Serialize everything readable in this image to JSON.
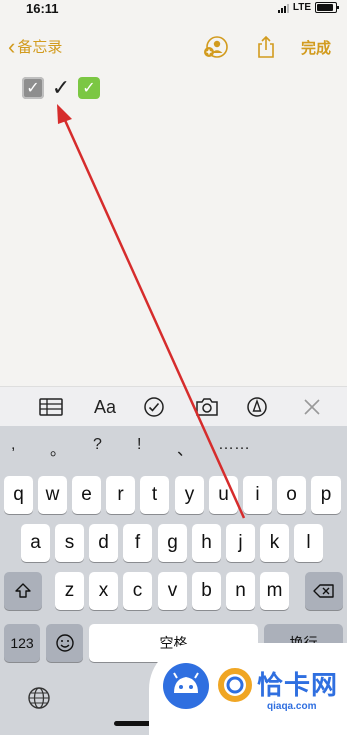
{
  "status_bar": {
    "time": "16:11",
    "network": "LTE"
  },
  "navbar": {
    "back_label": "备忘录",
    "done_label": "完成"
  },
  "note": {
    "icons": [
      "checkbox-gray-icon",
      "check-mark-icon",
      "checkbox-green-icon"
    ]
  },
  "toolbar": {
    "format_label": "Aa"
  },
  "keyboard": {
    "symbols": [
      ",",
      "。",
      "?",
      "!",
      "、",
      "……"
    ],
    "row1": [
      "q",
      "w",
      "e",
      "r",
      "t",
      "y",
      "u",
      "i",
      "o",
      "p"
    ],
    "row2": [
      "a",
      "s",
      "d",
      "f",
      "g",
      "h",
      "j",
      "k",
      "l"
    ],
    "row3": [
      "z",
      "x",
      "c",
      "v",
      "b",
      "n",
      "m"
    ],
    "numbers_label": "123",
    "space_label": "空格",
    "return_label": "换行"
  },
  "watermark": {
    "text": "恰卡网",
    "domain": "qiaqa.com"
  },
  "colors": {
    "accent": "#d29b1e",
    "annotation_arrow": "#d62c2c"
  }
}
